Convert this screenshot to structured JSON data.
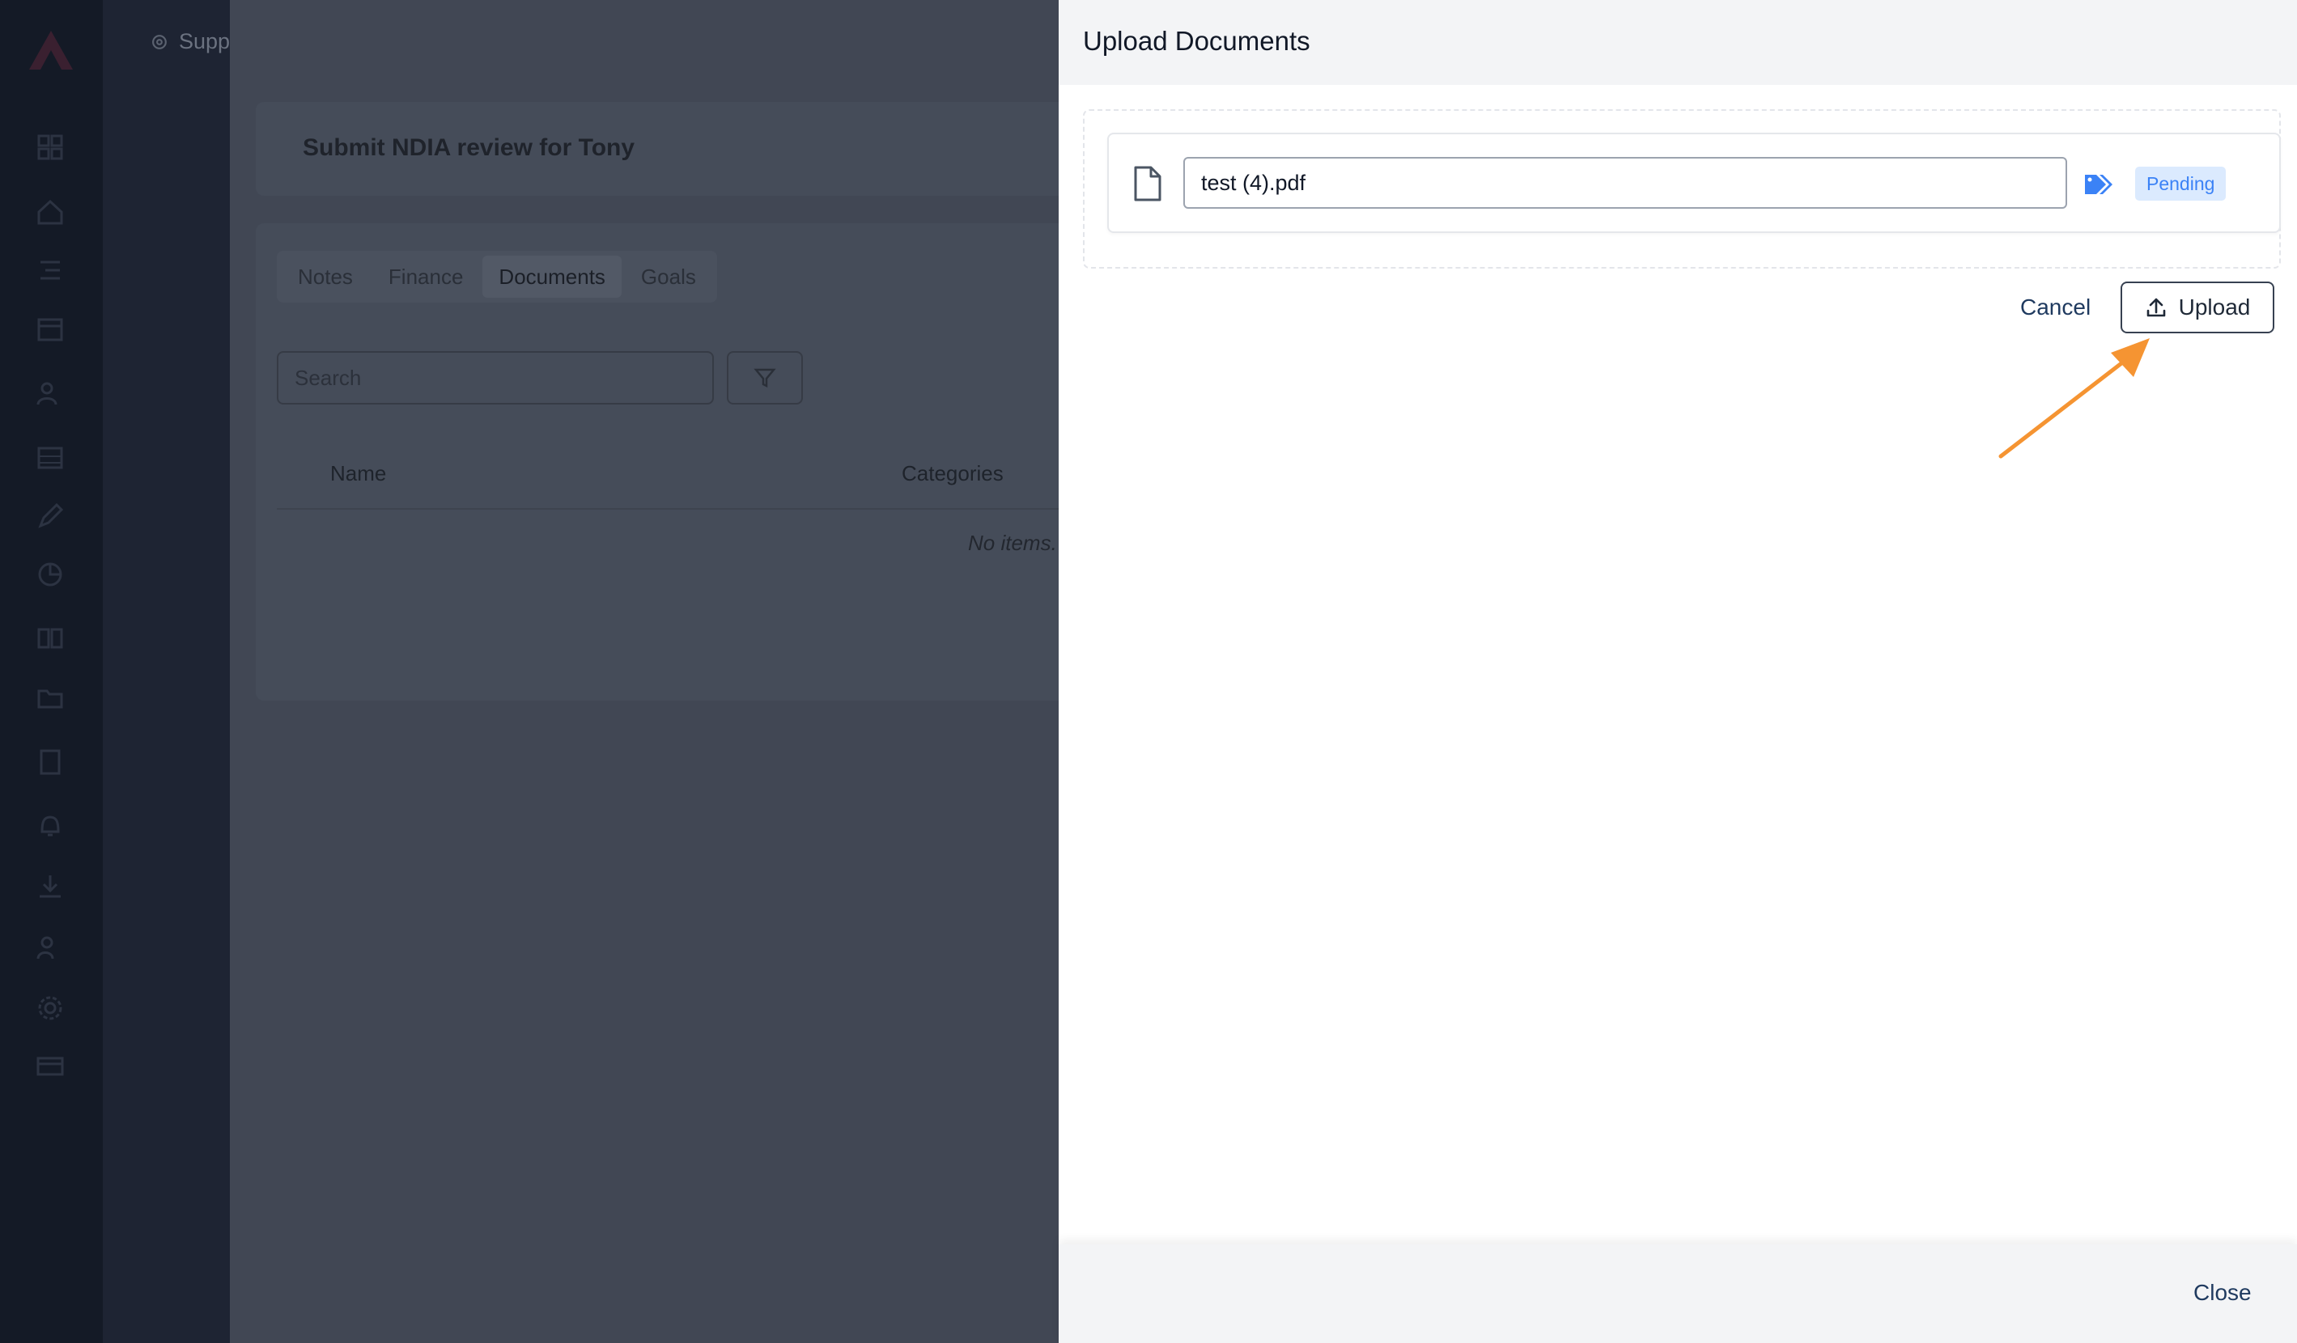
{
  "background": {
    "subnav": {
      "label": "Supp"
    },
    "page_title": "Submit NDIA review for Tony",
    "tabs": [
      {
        "label": "Notes",
        "active": false
      },
      {
        "label": "Finance",
        "active": false
      },
      {
        "label": "Documents",
        "active": true
      },
      {
        "label": "Goals",
        "active": false
      }
    ],
    "search": {
      "placeholder": "Search"
    },
    "table": {
      "columns": [
        "Name",
        "Categories"
      ],
      "empty_text": "No items."
    }
  },
  "drawer": {
    "title": "Upload Documents",
    "files": [
      {
        "name": "test (4).pdf",
        "status": "Pending"
      }
    ],
    "cancel_label": "Cancel",
    "upload_label": "Upload",
    "close_label": "Close"
  },
  "colors": {
    "accent_blue": "#3b82f6",
    "annotation_arrow": "#f59432"
  }
}
